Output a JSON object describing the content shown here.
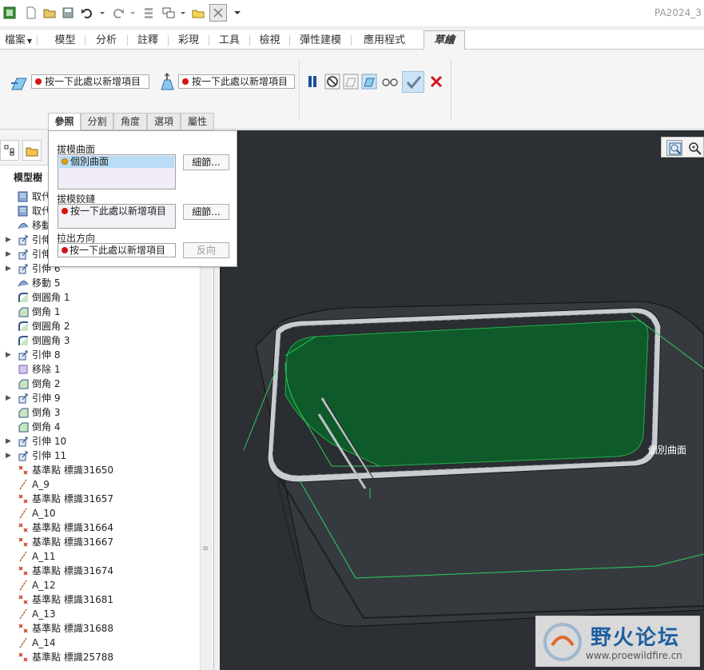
{
  "app": {
    "title": "PA2024_3"
  },
  "ribbon_tabs": [
    "檔案",
    "模型",
    "分析",
    "註釋",
    "彩現",
    "工具",
    "檢視",
    "彈性建模",
    "應用程式",
    "草繪"
  ],
  "ribbon": {
    "collector1": "按一下此處以新增項目",
    "collector2": "按一下此處以新增項目"
  },
  "sub_tabs": [
    "參照",
    "分割",
    "角度",
    "選項",
    "屬性"
  ],
  "left_panel": {
    "title": "模型樹",
    "tree": [
      {
        "label": "取代",
        "icon": "replace-surface-icon"
      },
      {
        "label": "取代",
        "icon": "replace-surface-icon"
      },
      {
        "label": "移動",
        "icon": "move-icon"
      },
      {
        "label": "引伸",
        "icon": "extrude-icon",
        "expand": true
      },
      {
        "label": "引伸",
        "icon": "extrude-icon",
        "expand": true
      },
      {
        "label": "引伸 6",
        "icon": "extrude-icon",
        "expand": true
      },
      {
        "label": "移動 5",
        "icon": "move-icon"
      },
      {
        "label": "倒圓角 1",
        "icon": "round-icon"
      },
      {
        "label": "倒角 1",
        "icon": "chamfer-icon"
      },
      {
        "label": "倒圓角 2",
        "icon": "round-icon"
      },
      {
        "label": "倒圓角 3",
        "icon": "round-icon"
      },
      {
        "label": "引伸 8",
        "icon": "extrude-icon",
        "expand": true
      },
      {
        "label": "移除 1",
        "icon": "remove-icon"
      },
      {
        "label": "倒角 2",
        "icon": "chamfer-icon"
      },
      {
        "label": "引伸 9",
        "icon": "extrude-icon",
        "expand": true
      },
      {
        "label": "倒角 3",
        "icon": "chamfer-icon"
      },
      {
        "label": "倒角 4",
        "icon": "chamfer-icon"
      },
      {
        "label": "引伸 10",
        "icon": "extrude-icon",
        "expand": true
      },
      {
        "label": "引伸 11",
        "icon": "extrude-icon",
        "expand": true
      },
      {
        "label": "基準點 標識31650",
        "icon": "datum-point-icon"
      },
      {
        "label": "A_9",
        "icon": "datum-axis-icon"
      },
      {
        "label": "基準點 標識31657",
        "icon": "datum-point-icon"
      },
      {
        "label": "A_10",
        "icon": "datum-axis-icon"
      },
      {
        "label": "基準點 標識31664",
        "icon": "datum-point-icon"
      },
      {
        "label": "基準點 標識31667",
        "icon": "datum-point-icon"
      },
      {
        "label": "A_11",
        "icon": "datum-axis-icon"
      },
      {
        "label": "基準點 標識31674",
        "icon": "datum-point-icon"
      },
      {
        "label": "A_12",
        "icon": "datum-axis-icon"
      },
      {
        "label": "基準點 標識31681",
        "icon": "datum-point-icon"
      },
      {
        "label": "A_13",
        "icon": "datum-axis-icon"
      },
      {
        "label": "基準點 標識31688",
        "icon": "datum-point-icon"
      },
      {
        "label": "A_14",
        "icon": "datum-axis-icon"
      },
      {
        "label": "基準點 標識25788",
        "icon": "datum-point-icon"
      }
    ]
  },
  "references_panel": {
    "draft_surfaces_label": "拔模曲面",
    "draft_surfaces_item": "個別曲面",
    "detail_button": "細節...",
    "draft_hinges_label": "拔模鉸鏈",
    "draft_hinges_item": "按一下此處以新增項目",
    "detail_button2": "細節...",
    "pull_direction_label": "拉出方向",
    "pull_direction_item": "按一下此處以新增項目",
    "flip_button": "反向"
  },
  "graphics": {
    "annotation": "個別曲面"
  },
  "watermark": {
    "text": "野火论坛",
    "url": "www.proewildfire.cn"
  },
  "colors": {
    "selection_green": "#0f5a2a",
    "background": "#2c2f33",
    "red_dot": "#d41414",
    "yellow_dot": "#e8a20a"
  }
}
